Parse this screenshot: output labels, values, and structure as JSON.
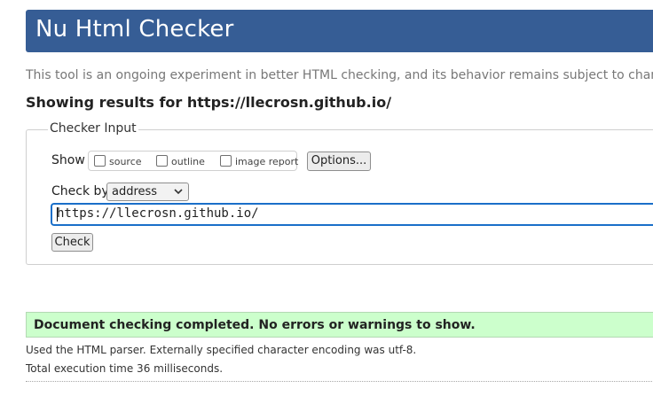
{
  "header": {
    "title": "Nu Html Checker",
    "color": "#365d95"
  },
  "tagline": "This tool is an ongoing experiment in better HTML checking, and its behavior remains subject to change",
  "showing_results": "Showing results for https://llecrosn.github.io/",
  "checker_input": {
    "legend": "Checker Input",
    "show_label": "Show",
    "options": [
      {
        "label": "source",
        "checked": false
      },
      {
        "label": "outline",
        "checked": false
      },
      {
        "label": "image report",
        "checked": false
      }
    ],
    "options_button": "Options...",
    "check_by_label": "Check by",
    "check_by_value": "address",
    "url_value": "https://llecrosn.github.io/",
    "check_button": "Check",
    "focus_color": "#1a6fc9"
  },
  "result": {
    "message": "Document checking completed. No errors or warnings to show.",
    "color": "#ccffcc"
  },
  "details": {
    "parser_line": "Used the HTML parser. Externally specified character encoding was utf-8.",
    "time_line": "Total execution time 36 milliseconds."
  }
}
